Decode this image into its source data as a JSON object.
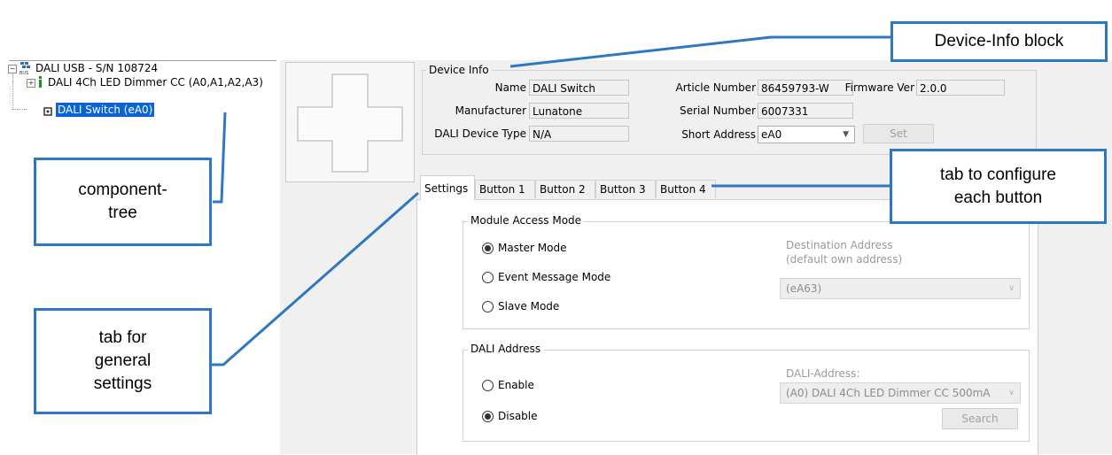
{
  "tree": {
    "root": "DALI USB - S/N 108724",
    "child1": "DALI 4Ch LED Dimmer CC (A0,A1,A2,A3)",
    "child2": "DALI Switch (eA0)",
    "root_icon": "bus-icon",
    "child1_icon": "dimmer-icon",
    "child2_icon": "switch-icon"
  },
  "device_info": {
    "title": "Device Info",
    "name_label": "Name",
    "name_value": "DALI Switch",
    "manufacturer_label": "Manufacturer",
    "manufacturer_value": "Lunatone",
    "device_type_label": "DALI Device Type",
    "device_type_value": "N/A",
    "article_label": "Article Number",
    "article_value": "86459793-W",
    "serial_label": "Serial Number",
    "serial_value": "6007331",
    "short_address_label": "Short Address",
    "short_address_value": "eA0",
    "firmware_label": "Firmware Ver",
    "firmware_value": "2.0.0",
    "set_button": "Set"
  },
  "tabs": [
    "Settings",
    "Button 1",
    "Button 2",
    "Button 3",
    "Button 4"
  ],
  "module_access": {
    "title": "Module Access Mode",
    "master": "Master Mode",
    "event": "Event Message Mode",
    "slave": "Slave Mode",
    "selected": "Master Mode",
    "dest_label_1": "Destination Address",
    "dest_label_2": "(default own address)",
    "dest_value": "(eA63)"
  },
  "dali_address": {
    "title": "DALI Address",
    "enable": "Enable",
    "disable": "Disable",
    "selected": "Disable",
    "addr_label": "DALI-Address:",
    "addr_value": "(A0) DALI 4Ch LED Dimmer CC 500mA",
    "search_button": "Search"
  },
  "callouts": {
    "device_info": "Device-Info block",
    "tree_line1": "component-",
    "tree_line2": "tree",
    "buttons_line1": "tab to configure",
    "buttons_line2": "each button",
    "general_line1": "tab for",
    "general_line2": "general",
    "general_line3": "settings"
  },
  "colors": {
    "callout_border": "#2e78c0",
    "selection": "#0a64d6",
    "panel_bg": "#f0f0f0"
  }
}
